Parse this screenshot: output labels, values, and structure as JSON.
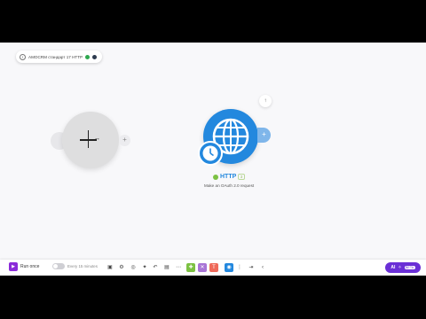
{
  "breadcrumb": {
    "back_icon": "arrow-left-icon",
    "scenario_name": "AMOCRM стандарт 17 HTTP"
  },
  "canvas": {
    "trigger_module": {
      "icon": "plus-cross-icon",
      "add_icon": "plus-icon",
      "add_label": "+"
    },
    "http_module": {
      "title": "HTTP",
      "id_badge": "3",
      "subtitle": "Make an OAuth 2.0 request",
      "main_icon": "globe-icon",
      "schedule_icon": "clock-icon",
      "add_label": "+",
      "up_label": "↑",
      "status_color": "#7cc142",
      "brand_color": "#2388de"
    }
  },
  "toolbar": {
    "run_once_label": "Run once",
    "schedule_label": "Every 15 minutes",
    "scheduling_enabled": false,
    "tools": [
      "save-icon",
      "settings-icon",
      "notes-icon",
      "auto-align-icon",
      "undo-icon",
      "explain-flow-icon",
      "more-icon"
    ],
    "colored_tools": [
      {
        "icon": "tools-icon",
        "color": "#7cc142"
      },
      {
        "icon": "flow-control-icon",
        "color": "#a874d6"
      },
      {
        "icon": "text-parser-icon",
        "color": "#ef6a5a"
      },
      {
        "icon": "json-icon",
        "color": "#2388de"
      }
    ],
    "ai_label": "AI",
    "ai_beta_label": "BETA",
    "accent_color": "#6a2fd6"
  }
}
